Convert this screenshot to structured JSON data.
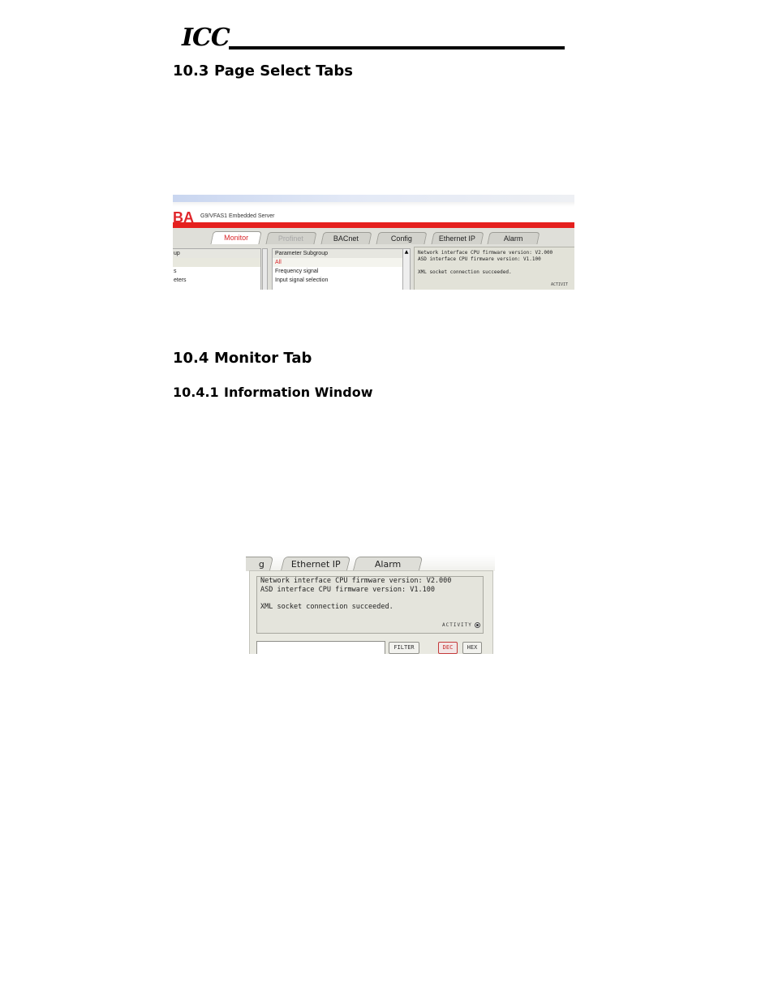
{
  "header": {
    "logo": "ICC"
  },
  "section_10_3": {
    "number": "10.3",
    "title": "Page Select Tabs"
  },
  "section_10_4": {
    "number": "10.4",
    "title": "Monitor Tab"
  },
  "section_10_4_1": {
    "number": "10.4.1",
    "title": "Information Window"
  },
  "screenshot_tabs": {
    "brand_fragment": "BA",
    "server_title": "G9/VFAS1 Embedded Server",
    "tabs": [
      {
        "label": "Monitor",
        "state": "active"
      },
      {
        "label": "Profinet",
        "state": "disabled"
      },
      {
        "label": "BACnet",
        "state": "normal"
      },
      {
        "label": "Config",
        "state": "normal"
      },
      {
        "label": "Ethernet IP",
        "state": "normal"
      },
      {
        "label": "Alarm",
        "state": "normal"
      }
    ],
    "group_list": [
      "up",
      "",
      "s",
      "eters",
      ""
    ],
    "subgroup_list": {
      "header": "Parameter Subgroup",
      "items": [
        "All",
        "Frequency signal",
        "Input signal selection",
        ""
      ]
    },
    "info_lines": [
      "Network interface CPU firmware version: V2.000",
      "ASD interface CPU firmware version: V1.100",
      "",
      "XML socket connection succeeded."
    ],
    "activity_fragment": "ACTIVIT"
  },
  "screenshot_info": {
    "tabs": [
      {
        "label": "g"
      },
      {
        "label": "Ethernet IP"
      },
      {
        "label": "Alarm"
      }
    ],
    "info_lines": [
      "Network interface CPU firmware version: V2.000",
      "ASD interface CPU firmware version: V1.100",
      "",
      "XML socket connection succeeded."
    ],
    "activity_label": "ACTIVITY",
    "filter_value": "",
    "filter_button": "FILTER",
    "dec_button": "DEC",
    "hex_button": "HEX"
  },
  "colors": {
    "brand_red": "#e5201e",
    "active_tab_text": "#d9262a",
    "panel_bg": "#e2e2d8"
  }
}
